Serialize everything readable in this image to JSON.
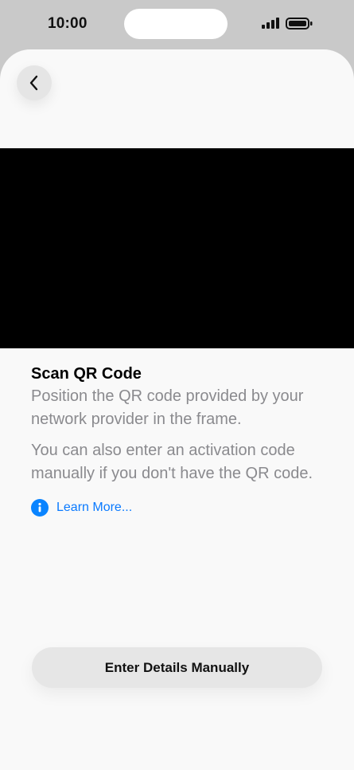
{
  "status_bar": {
    "time": "10:00",
    "signal_icon": "cellular-signal-icon",
    "battery_icon": "battery-icon"
  },
  "nav": {
    "back_icon": "chevron-left-icon"
  },
  "content": {
    "title": "Scan QR Code",
    "paragraph_1": "Position the QR code provided by your network provider in the frame.",
    "paragraph_2": "You can also enter an activation code manually if you don't have the QR code.",
    "learn_more_icon": "info-icon",
    "learn_more_label": "Learn More..."
  },
  "actions": {
    "manual_button_label": "Enter Details Manually"
  },
  "colors": {
    "accent": "#0a84ff",
    "secondary_text": "#8a8a8e",
    "camera_view": "#000000"
  }
}
